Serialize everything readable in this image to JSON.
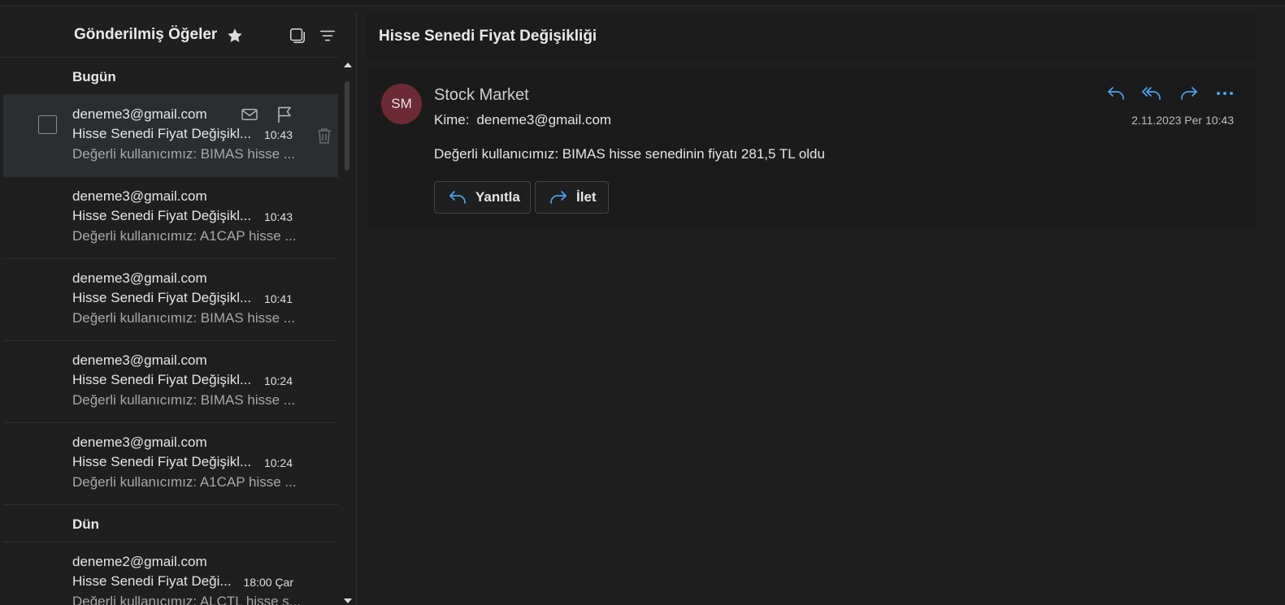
{
  "folder": {
    "title": "Gönderilmiş Öğeler"
  },
  "groups": [
    {
      "label": "Bugün",
      "messages": [
        {
          "sender": "deneme3@gmail.com",
          "subject": "Hisse Senedi Fiyat Değişikl...",
          "time": "10:43",
          "preview": "Değerli kullanıcımız: BIMAS hisse ..."
        },
        {
          "sender": "deneme3@gmail.com",
          "subject": "Hisse Senedi Fiyat Değişikl...",
          "time": "10:43",
          "preview": "Değerli kullanıcımız: A1CAP hisse ..."
        },
        {
          "sender": "deneme3@gmail.com",
          "subject": "Hisse Senedi Fiyat Değişikl...",
          "time": "10:41",
          "preview": "Değerli kullanıcımız: BIMAS hisse ..."
        },
        {
          "sender": "deneme3@gmail.com",
          "subject": "Hisse Senedi Fiyat Değişikl...",
          "time": "10:24",
          "preview": "Değerli kullanıcımız: BIMAS hisse ..."
        },
        {
          "sender": "deneme3@gmail.com",
          "subject": "Hisse Senedi Fiyat Değişikl...",
          "time": "10:24",
          "preview": "Değerli kullanıcımız: A1CAP hisse ..."
        }
      ]
    },
    {
      "label": "Dün",
      "messages": [
        {
          "sender": "deneme2@gmail.com",
          "subject": "Hisse Senedi Fiyat Deği...",
          "time": "18:00 Çar",
          "preview": "Değerli kullanıcımız: ALCTL hisse s..."
        }
      ]
    }
  ],
  "reading": {
    "title": "Hisse Senedi Fiyat Değişikliği",
    "avatar_initials": "SM",
    "avatar_color": "#6b2a35",
    "from": "Stock Market",
    "to_label": "Kime:",
    "to": "deneme3@gmail.com",
    "date": "2.11.2023 Per 10:43",
    "body": "Değerli kullanıcımız: BIMAS hisse senedinin fiyatı 281,5 TL oldu",
    "reply_label": "Yanıtla",
    "forward_label": "İlet"
  },
  "colors": {
    "accent": "#4aa3ef"
  },
  "icons": [
    "star-icon",
    "select-mode-icon",
    "filter-icon",
    "mail-read-icon",
    "flag-icon",
    "trash-icon",
    "reply-icon",
    "reply-all-icon",
    "forward-icon",
    "more-icon"
  ]
}
